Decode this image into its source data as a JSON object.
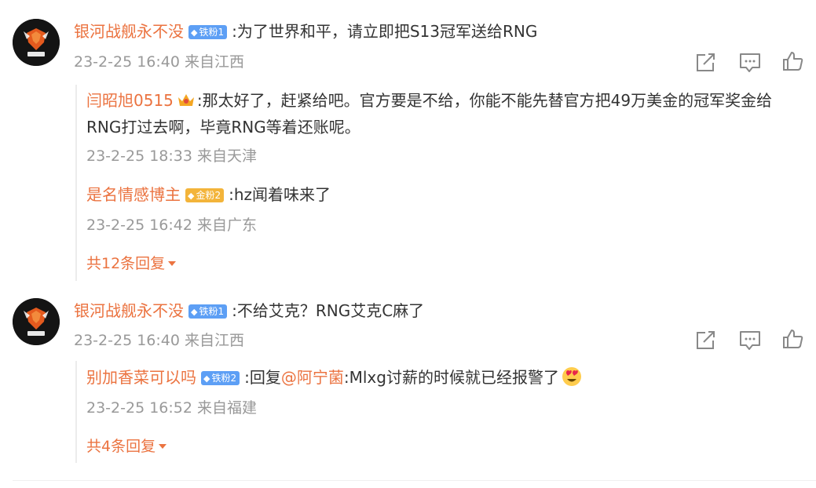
{
  "comments": [
    {
      "user": "银河战舰永不没",
      "badge": "铁粉1",
      "text": ":为了世界和平，请立即把S13冠军送给RNG",
      "meta": "23-2-25 16:40 来自江西",
      "replies": [
        {
          "user": "闫昭旭0515",
          "text_line1": ":那太好了，赶紧给吧。官方要是不给，你能不能先替官方把49万美金的冠军奖金给",
          "text_line2": "RNG打过去啊，毕竟RNG等着还账呢。",
          "meta": "23-2-25 18:33 来自天津"
        },
        {
          "user": "是名情感博主",
          "badge": "金粉2",
          "text": ":hz闻着味来了",
          "meta": "23-2-25 16:42 来自广东"
        }
      ],
      "more_label": "共12条回复"
    },
    {
      "user": "银河战舰永不没",
      "badge": "铁粉1",
      "text": ":不给艾克？RNG艾克C麻了",
      "meta": "23-2-25 16:40 来自江西",
      "replies": [
        {
          "user": "别加香菜可以吗",
          "badge": "铁粉2",
          "prefix": ":回复",
          "mention": "@阿宁菌",
          "text": ":Mlxg讨薪的时候就已经报警了",
          "meta": "23-2-25 16:52 来自福建"
        }
      ],
      "more_label": "共4条回复"
    }
  ],
  "icons": {
    "share": "share-icon",
    "comment": "comment-icon",
    "like": "like-icon",
    "crown": "crown-icon",
    "emoji": "heart-eyes-emoji-icon"
  },
  "colors": {
    "username": "#eb7340",
    "meta": "#999999",
    "badge_blue": "#5d9ff5",
    "badge_gold": "#f3b43a"
  }
}
